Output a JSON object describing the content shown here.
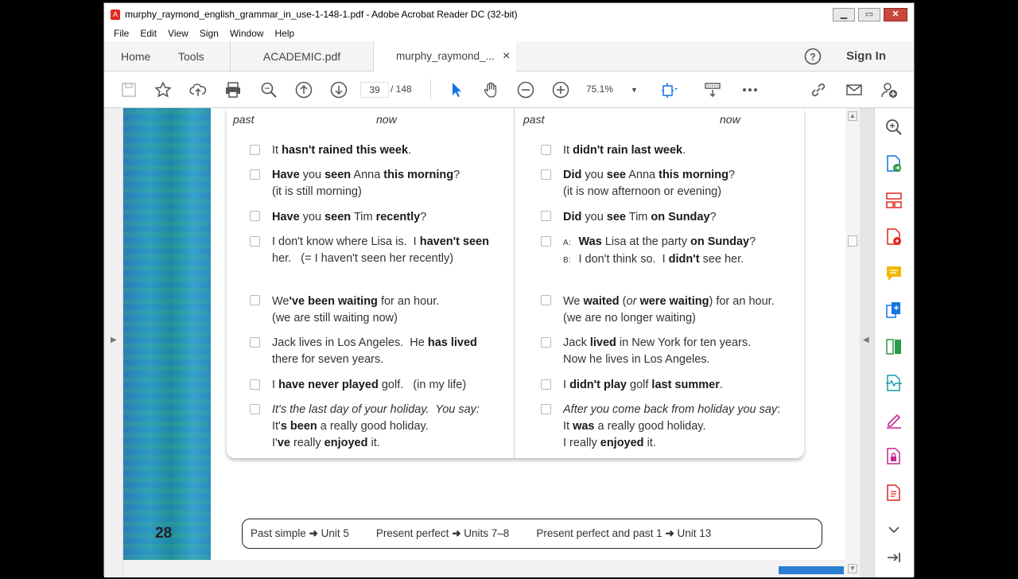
{
  "window": {
    "title": "murphy_raymond_english_grammar_in_use-1-148-1.pdf - Adobe Acrobat Reader DC (32-bit)"
  },
  "menu": [
    "File",
    "Edit",
    "View",
    "Sign",
    "Window",
    "Help"
  ],
  "tabs": {
    "home": "Home",
    "tools": "Tools",
    "doc1": "ACADEMIC.pdf",
    "doc2": "murphy_raymond_...",
    "close": "×",
    "signin": "Sign In"
  },
  "toolbar": {
    "page_current": "39",
    "page_total": "/  148",
    "zoom": "75.1%"
  },
  "document": {
    "page_number": "28",
    "left_col": {
      "past": "past",
      "now": "now"
    },
    "right_col": {
      "past": "past",
      "now": "now"
    },
    "footer": {
      "item1_a": "Past simple ",
      "item1_b": "Unit 5",
      "item2_a": "Present perfect ",
      "item2_b": "Units 7–8",
      "item3_a": "Present perfect and past 1 ",
      "item3_b": "Unit 13",
      "arrow": "➜"
    }
  },
  "colors": {
    "accent_red": "#e0261f",
    "toolbar_blue": "#1473e6",
    "panel_icon_green": "#2a9c4a"
  }
}
